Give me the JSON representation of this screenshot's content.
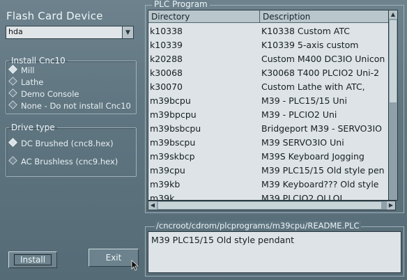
{
  "title": "Flash Card Device",
  "device": {
    "value": "hda"
  },
  "install_group": {
    "legend": "Install Cnc10",
    "options": [
      "Mill",
      "Lathe",
      "Demo Console",
      "None - Do not install Cnc10"
    ],
    "selected": "Mill"
  },
  "drive_group": {
    "legend": "Drive type",
    "options": [
      "DC Brushed (cnc8.hex)",
      "AC Brushless (cnc9.hex)"
    ],
    "selected": "DC Brushed (cnc8.hex)"
  },
  "buttons": {
    "install": "Install",
    "exit": "Exit"
  },
  "plc": {
    "label": "PLC Program",
    "columns": [
      "Directory",
      "Description"
    ],
    "rows": [
      {
        "dir": "k10338",
        "desc": "K10338 Custom ATC"
      },
      {
        "dir": "k10339",
        "desc": "K10339 5-axis custom"
      },
      {
        "dir": "k20288",
        "desc": "Custom M400 DC3IO Unicon"
      },
      {
        "dir": "k30068",
        "desc": "K30068 T400 PLCIO2 Uni-2"
      },
      {
        "dir": "k30070",
        "desc": "Custom Lathe with ATC,"
      },
      {
        "dir": "m39bcpu",
        "desc": "M39 - PLC15/15 Uni"
      },
      {
        "dir": "m39bpcpu",
        "desc": "M39 - PLCIO2   Uni"
      },
      {
        "dir": "m39bsbcpu",
        "desc": "Bridgeport M39 - SERVO3IO"
      },
      {
        "dir": "m39bscpu",
        "desc": "M39 SERVO3IO Uni"
      },
      {
        "dir": "m39skbcp",
        "desc": "M39S Keyboard Jogging"
      },
      {
        "dir": "m39cpu",
        "desc": "M39 PLC15/15 Old style pen"
      },
      {
        "dir": "m39kb",
        "desc": "M39 Keyboard???  Old style"
      },
      {
        "dir": "m39k",
        "desc": "M39 PLCIO2 OLLOL"
      }
    ]
  },
  "readme": {
    "path": "/cncroot/cdrom/plcprograms/m39cpu/README.PLC",
    "text": "M39 PLC15/15 Old style pendant"
  },
  "colors": {
    "background": "#5f7580",
    "list_bg": "#dde3e6",
    "header_bg": "#b9c6cc"
  }
}
